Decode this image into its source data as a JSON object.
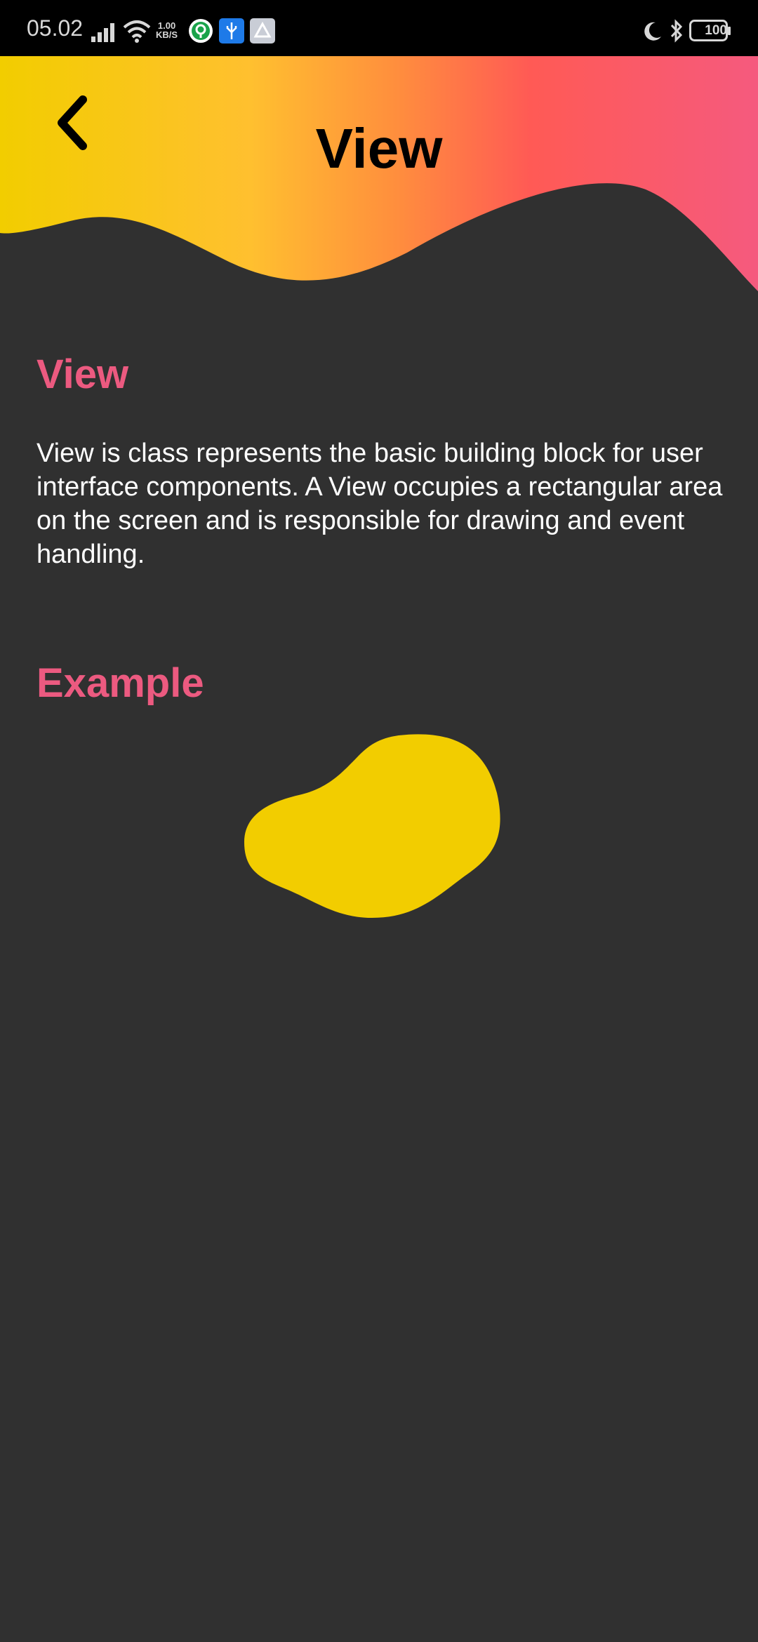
{
  "status_bar": {
    "time": "05.02",
    "net_speed_value": "1.00",
    "net_speed_unit": "KB/S",
    "battery": "100",
    "icons": [
      "signal-icon",
      "wifi-icon",
      "app-notification-icon",
      "usb-icon",
      "app-notification-icon",
      "moon-icon",
      "bluetooth-icon",
      "battery-icon"
    ]
  },
  "header": {
    "title": "View",
    "back_icon": "chevron-left-icon",
    "gradient_colors": [
      "#f2cd00",
      "#ffc02f",
      "#ff8f3d",
      "#ff5a55",
      "#f55a7e"
    ]
  },
  "content": {
    "section1_heading": "View",
    "section1_body": "View is class represents the basic building block for user interface components. A View occupies a rectangular area on the screen and is responsible for drawing and event handling.",
    "section2_heading": "Example",
    "example_shape_color": "#f2cd00"
  },
  "colors": {
    "background": "#303030",
    "accent_heading": "#ec5a80",
    "body_text": "#ffffff"
  }
}
